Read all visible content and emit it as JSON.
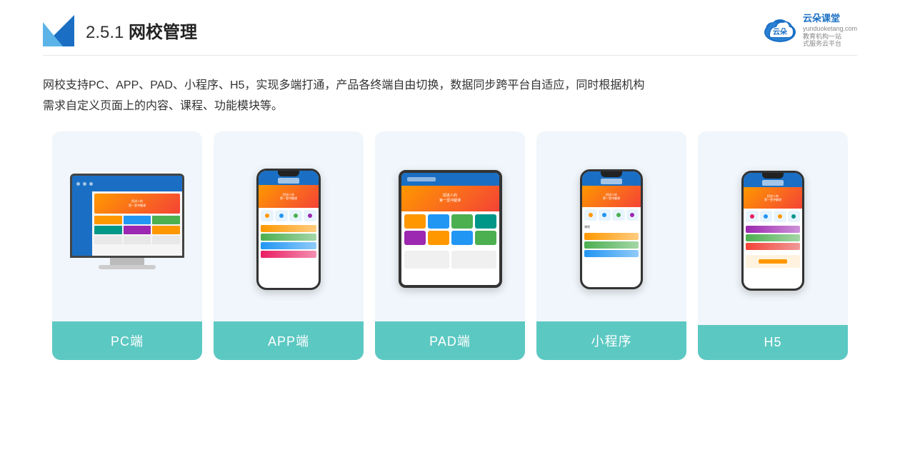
{
  "header": {
    "section_number": "2.5.1",
    "title_prefix": "2.5.1 ",
    "title_bold": "网校管理",
    "brand": {
      "name": "云朵课堂",
      "domain": "yunduoketang.com",
      "tagline1": "教育机构一站",
      "tagline2": "式服务云平台"
    }
  },
  "description": {
    "line1": "网校支持PC、APP、PAD、小程序、H5，实现多端打通，产品各终端自由切换，数据同步跨平台自适应，同时根据机构",
    "line2": "需求自定义页面上的内容、课程、功能模块等。"
  },
  "cards": [
    {
      "id": "pc",
      "label": "PC端"
    },
    {
      "id": "app",
      "label": "APP端"
    },
    {
      "id": "pad",
      "label": "PAD端"
    },
    {
      "id": "miniapp",
      "label": "小程序"
    },
    {
      "id": "h5",
      "label": "H5"
    }
  ],
  "colors": {
    "accent_teal": "#5cc8c2",
    "brand_blue": "#1a6fc4",
    "card_bg": "#edf4fb"
  }
}
